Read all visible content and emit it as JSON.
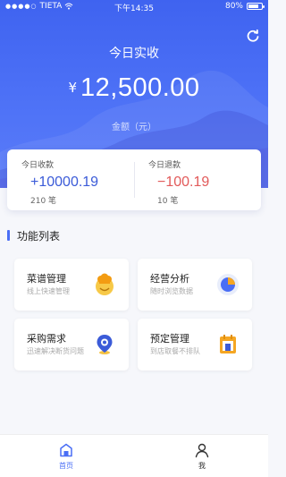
{
  "status_bar": {
    "carrier": "TIETA",
    "time": "下午14:35",
    "battery": "80%",
    "battery_level": 0.8
  },
  "hero": {
    "title": "今日实收",
    "currency": "¥",
    "amount": "12,500.00",
    "unit_label": "金额（元）"
  },
  "stats": {
    "income": {
      "label": "今日收款",
      "value": "+10000.19",
      "count": "210 笔"
    },
    "refund": {
      "label": "今日退款",
      "value": "−100.19",
      "count": "10 笔"
    }
  },
  "section": {
    "title": "功能列表"
  },
  "tiles": [
    {
      "title": "菜谱管理",
      "subtitle": "线上快速管理",
      "icon": "chef-icon"
    },
    {
      "title": "经营分析",
      "subtitle": "随时浏览数据",
      "icon": "pie-chart-icon"
    },
    {
      "title": "采购需求",
      "subtitle": "迅速解决断货问题",
      "icon": "location-pin-icon"
    },
    {
      "title": "预定管理",
      "subtitle": "到店取餐不排队",
      "icon": "booking-icon"
    }
  ],
  "tabbar": {
    "items": [
      {
        "label": "首页",
        "icon": "home-icon"
      },
      {
        "label": "我",
        "icon": "user-icon"
      }
    ]
  },
  "colors": {
    "primary": "#4a6ef5",
    "income": "#3b5bd8",
    "refund": "#e25a5a"
  }
}
